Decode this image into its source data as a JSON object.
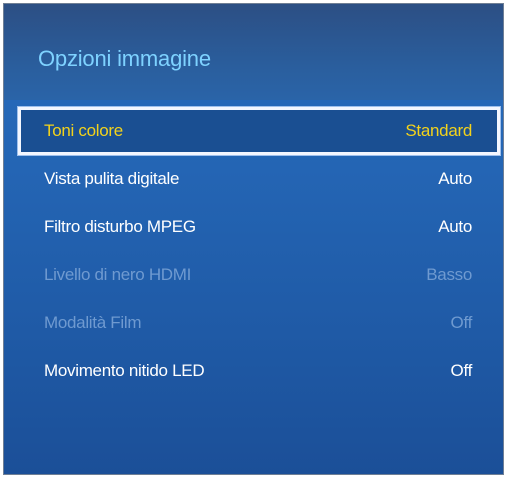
{
  "menu": {
    "title": "Opzioni immagine",
    "items": [
      {
        "label": "Toni colore",
        "value": "Standard",
        "state": "selected"
      },
      {
        "label": "Vista pulita digitale",
        "value": "Auto",
        "state": "enabled"
      },
      {
        "label": "Filtro disturbo MPEG",
        "value": "Auto",
        "state": "enabled"
      },
      {
        "label": "Livello di nero HDMI",
        "value": "Basso",
        "state": "disabled"
      },
      {
        "label": "Modalità Film",
        "value": "Off",
        "state": "disabled"
      },
      {
        "label": "Movimento nitido LED",
        "value": "Off",
        "state": "enabled"
      }
    ]
  },
  "colors": {
    "background": "#2465b4",
    "title": "#7ed2ff",
    "selected_text": "#f2d21c",
    "selected_border": "#f4f7ff",
    "enabled_text": "#ffffff",
    "disabled_text": "#6f9ad0"
  }
}
